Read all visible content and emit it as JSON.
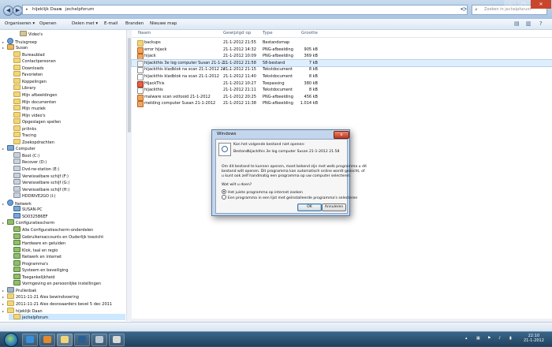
{
  "address": {
    "segments": [
      "hijeklijk Daan",
      "jechelpforum"
    ]
  },
  "search": {
    "placeholder": "Zoeken in jechelpforum"
  },
  "toolbar": {
    "organize": "Organiseren ▾",
    "open": "Openen",
    "share": "Delen met ▾",
    "email": "E-mail",
    "burn": "Branden",
    "new_folder": "Nieuwe map"
  },
  "nav": [
    {
      "label": "Video's",
      "icon": "lib",
      "indent": 2
    },
    {
      "label": "Thuisgroep",
      "icon": "net",
      "indent": 0
    },
    {
      "label": "Susan",
      "icon": "user",
      "indent": 0
    },
    {
      "label": "Bureaublad",
      "icon": "fold",
      "indent": 1
    },
    {
      "label": "Contactpersonen",
      "icon": "fold",
      "indent": 1
    },
    {
      "label": "Downloads",
      "icon": "fold",
      "indent": 1
    },
    {
      "label": "Favorieten",
      "icon": "fold",
      "indent": 1
    },
    {
      "label": "Koppelingen",
      "icon": "fold",
      "indent": 1
    },
    {
      "label": "Library",
      "icon": "fold",
      "indent": 1
    },
    {
      "label": "Mijn afbeeldingen",
      "icon": "fold",
      "indent": 1
    },
    {
      "label": "Mijn documenten",
      "icon": "fold",
      "indent": 1
    },
    {
      "label": "Mijn muziek",
      "icon": "fold",
      "indent": 1
    },
    {
      "label": "Mijn video's",
      "icon": "fold",
      "indent": 1
    },
    {
      "label": "Opgeslagen spellen",
      "icon": "fold",
      "indent": 1
    },
    {
      "label": "prilinks",
      "icon": "fold",
      "indent": 1
    },
    {
      "label": "Tracing",
      "icon": "fold",
      "indent": 1
    },
    {
      "label": "Zoekopdrachten",
      "icon": "fold",
      "indent": 1
    },
    {
      "label": "Computer",
      "icon": "pc",
      "indent": 0
    },
    {
      "label": "Boot (C:)",
      "icon": "drv",
      "indent": 1
    },
    {
      "label": "Recover (D:)",
      "icon": "drv",
      "indent": 1
    },
    {
      "label": "Dvd-rw-station (E:)",
      "icon": "drv",
      "indent": 1
    },
    {
      "label": "Verwisselbare schijf (F:)",
      "icon": "drv",
      "indent": 1
    },
    {
      "label": "Verwisselbare schijf (G:)",
      "icon": "drv",
      "indent": 1
    },
    {
      "label": "Verwisselbare schijf (H:)",
      "icon": "drv",
      "indent": 1
    },
    {
      "label": "HDDRIVE2GO (I:)",
      "icon": "drv",
      "indent": 1
    },
    {
      "label": "Netwerk",
      "icon": "net",
      "indent": 0
    },
    {
      "label": "SUSAN-PC",
      "icon": "pc",
      "indent": 1
    },
    {
      "label": "SO0325B6EF",
      "icon": "pc",
      "indent": 1
    },
    {
      "label": "Configuratiescherm",
      "icon": "cp",
      "indent": 0
    },
    {
      "label": "Alle Configuratiescherm-onderdelen",
      "icon": "cp",
      "indent": 1
    },
    {
      "label": "Gebruikersaccounts en Ouderlijk toezicht",
      "icon": "cp",
      "indent": 1
    },
    {
      "label": "Hardware en geluiden",
      "icon": "cp",
      "indent": 1
    },
    {
      "label": "Klok, taal en regio",
      "icon": "cp",
      "indent": 1
    },
    {
      "label": "Netwerk en internet",
      "icon": "cp",
      "indent": 1
    },
    {
      "label": "Programma's",
      "icon": "cp",
      "indent": 1
    },
    {
      "label": "Systeem en beveiliging",
      "icon": "cp",
      "indent": 1
    },
    {
      "label": "Toegankelijkheid",
      "icon": "cp",
      "indent": 1
    },
    {
      "label": "Vormgeving en persoonlijke instellingen",
      "icon": "cp",
      "indent": 1
    },
    {
      "label": "Prullenbak",
      "icon": "bin",
      "indent": 0
    },
    {
      "label": "2011-11-21 Alex bewindvoering",
      "icon": "fold",
      "indent": 0
    },
    {
      "label": "2011-11-21 Alex desnoaarders bevel 5 dec 2011",
      "icon": "fold",
      "indent": 0
    },
    {
      "label": "hijeklijk Daan",
      "icon": "fold",
      "indent": 0
    },
    {
      "label": "jechelpforum",
      "icon": "fold",
      "indent": 1,
      "selected": true
    }
  ],
  "columns": {
    "name": "Naam",
    "date": "Gewijzigd op",
    "type": "Type",
    "size": "Grootte"
  },
  "files": [
    {
      "name": "backups",
      "date": "21-1-2012 21:55",
      "type": "Bestandsmap",
      "size": "",
      "kind": "folder"
    },
    {
      "name": "error hijack",
      "date": "21-1-2012 14:32",
      "type": "PNG-afbeelding",
      "size": "905 kB",
      "kind": "png"
    },
    {
      "name": "hijack",
      "date": "21-1-2012 10:09",
      "type": "PNG-afbeelding",
      "size": "369 kB",
      "kind": "png"
    },
    {
      "name": "hijackthis 3e log computer Susan  21-1-2...",
      "date": "21-1-2012 21:58",
      "type": "58-bestand",
      "size": "7 kB",
      "kind": "file",
      "selected": true
    },
    {
      "name": "hijackthis kladblok na scan 21-1-2012  2e ...",
      "date": "21-1-2012 21:15",
      "type": "Tekstdocument",
      "size": "8 kB",
      "kind": "txt"
    },
    {
      "name": "hijackthis kladblok na scan 21-1-2012",
      "date": "21-1-2012 11:40",
      "type": "Tekstdocument",
      "size": "8 kB",
      "kind": "txt"
    },
    {
      "name": "HijackThis",
      "date": "21-1-2012 10:27",
      "type": "Toepassing",
      "size": "380 kB",
      "kind": "app"
    },
    {
      "name": "hijackthis",
      "date": "21-1-2012 21:11",
      "type": "Tekstdocument",
      "size": "8 kB",
      "kind": "txt"
    },
    {
      "name": "malware scan voltooid 21-1-2012",
      "date": "21-1-2012 20:25",
      "type": "PNG-afbeelding",
      "size": "456 kB",
      "kind": "png"
    },
    {
      "name": "melding computer Susan 21-1-2012",
      "date": "21-1-2012 11:38",
      "type": "PNG-afbeelding",
      "size": "1.014 kB",
      "kind": "png"
    }
  ],
  "dialog": {
    "title": "Windows",
    "close": "x",
    "heading": "Kan het volgende bestand niet openen:",
    "file_label": "Bestand:",
    "file_value": "hijackthis 3e log computer Susan  21-1-2012     21.58",
    "message": [
      "Om dit bestand te kunnen openen, moet bekend zijn met welk programma u dit",
      "bestand wilt openen. Dit programma kan automatisch online wordt gezocht, of",
      "u kunt ook zelf handmatig een programma op uw computer selecteren."
    ],
    "question": "Wat wilt u doen?",
    "option1": "Het juiste programma op internet zoeken",
    "option2": "Een programma in een lijst met geïnstalleerde programma's selecteren",
    "ok": "OK",
    "cancel": "Annuleren"
  },
  "clock": {
    "time": "22:10",
    "date": "21-1-2012"
  }
}
